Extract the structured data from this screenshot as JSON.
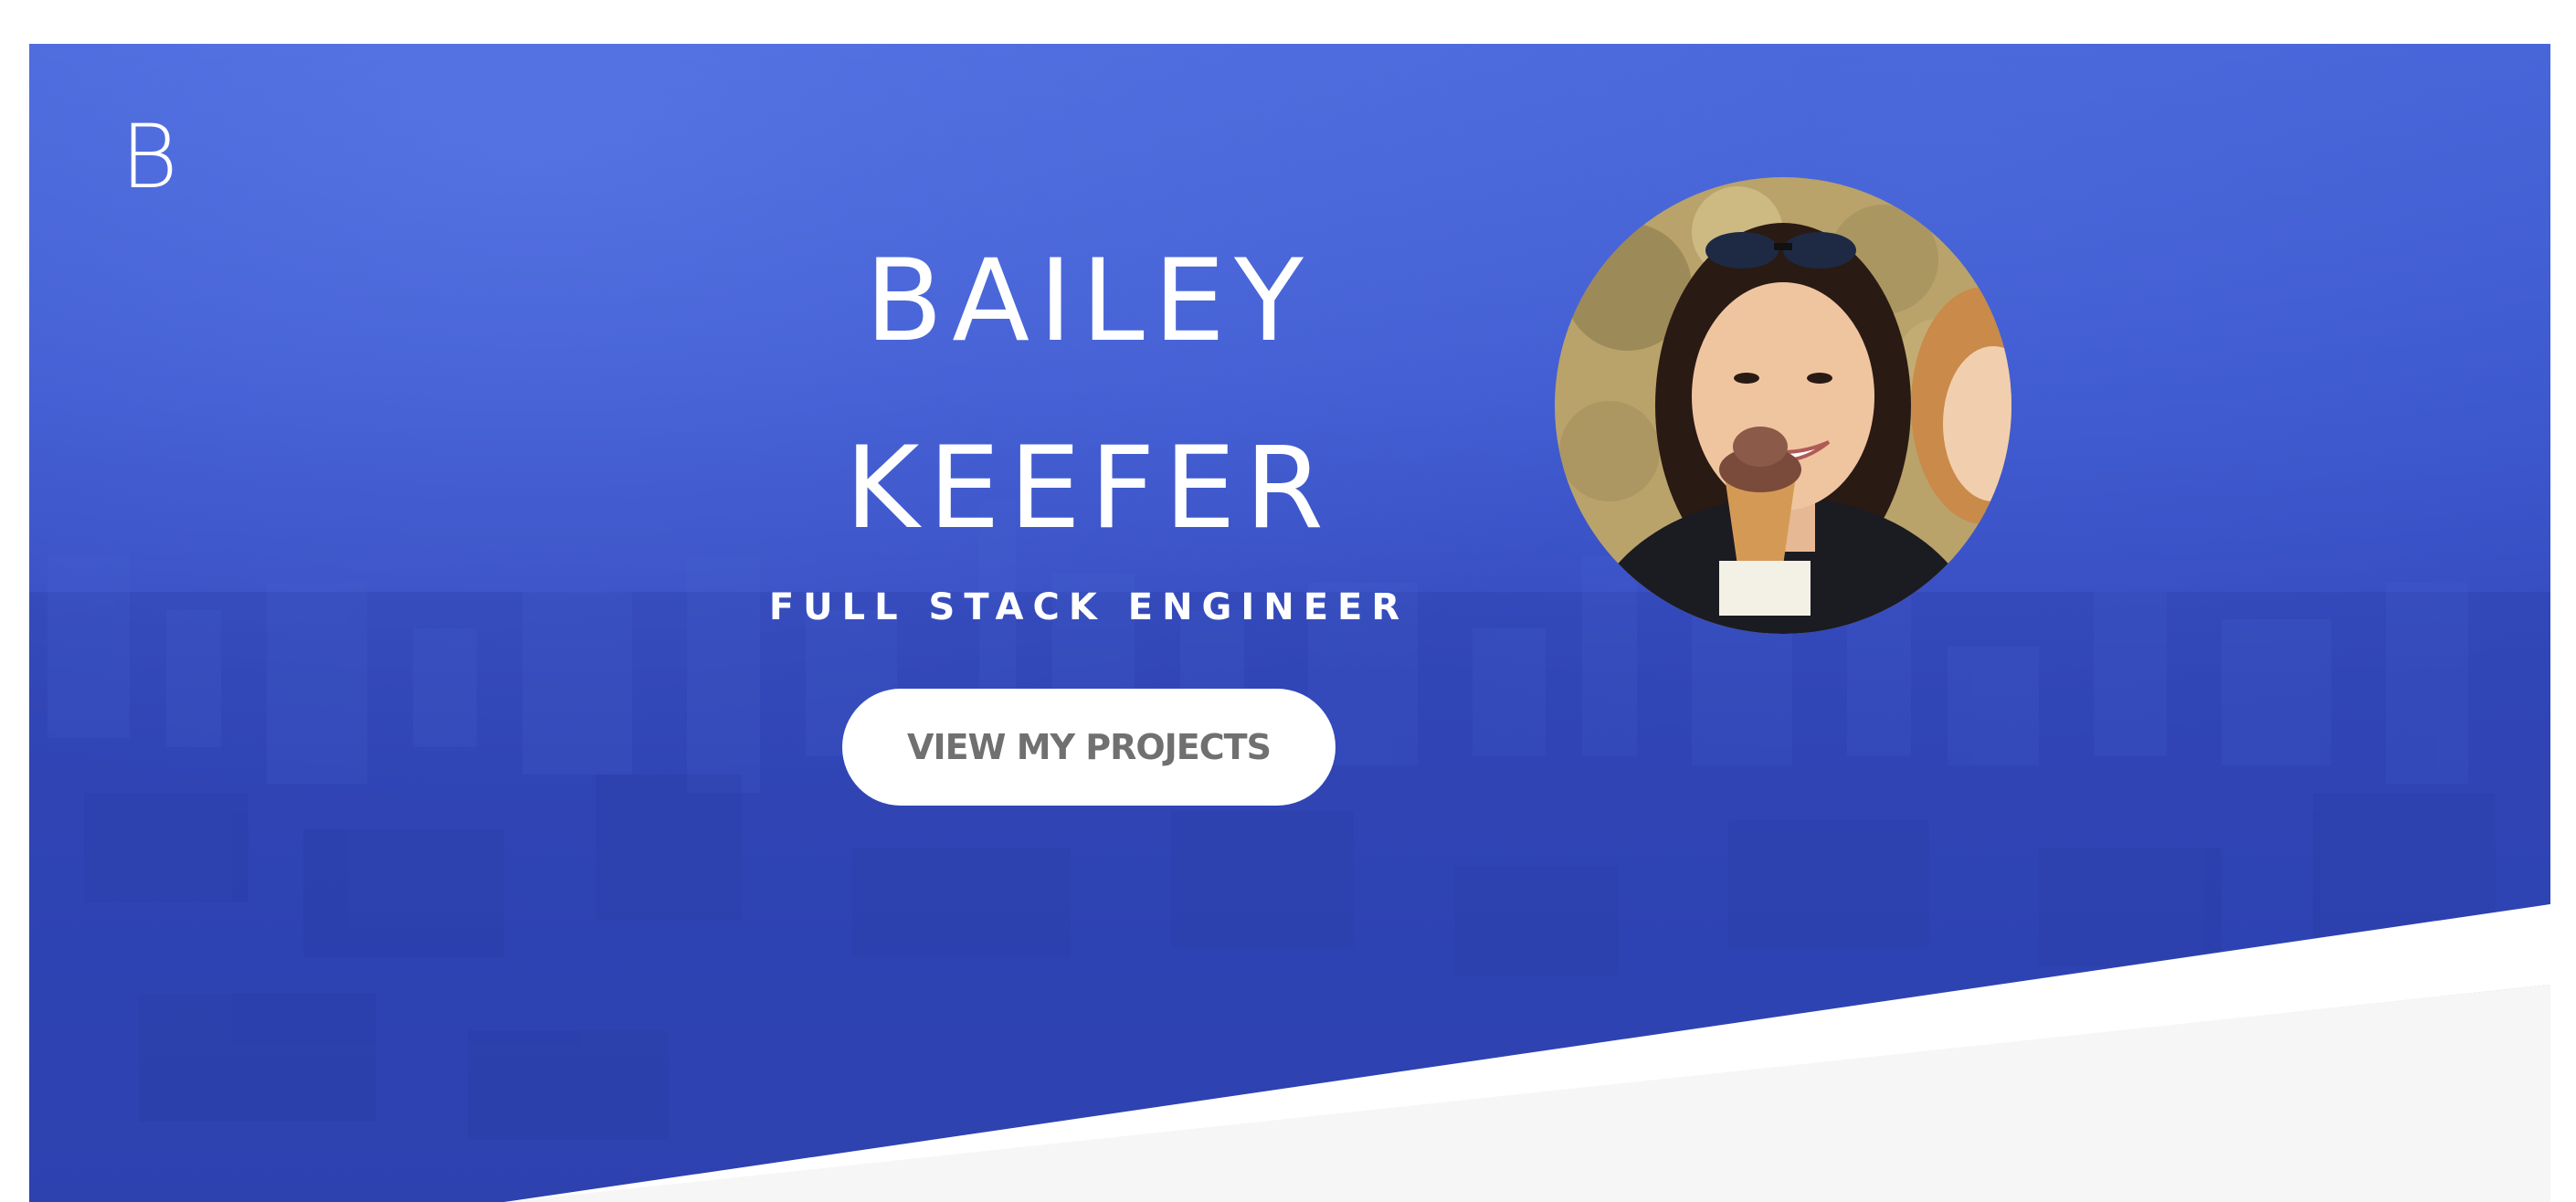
{
  "header": {
    "logo": "B"
  },
  "hero": {
    "name_first": "BAILEY",
    "name_last": "KEEFER",
    "role": "FULL STACK ENGINEER",
    "cta_label": "VIEW MY PROJECTS",
    "profile_photo_icon": "profile-photo",
    "background": "city-skyline-photo"
  },
  "colors": {
    "hero_blue": "#3b56cc",
    "lower_panel": "#f6f6f6",
    "button_bg": "#ffffff",
    "button_text": "#707070",
    "text_light": "#ffffff"
  }
}
